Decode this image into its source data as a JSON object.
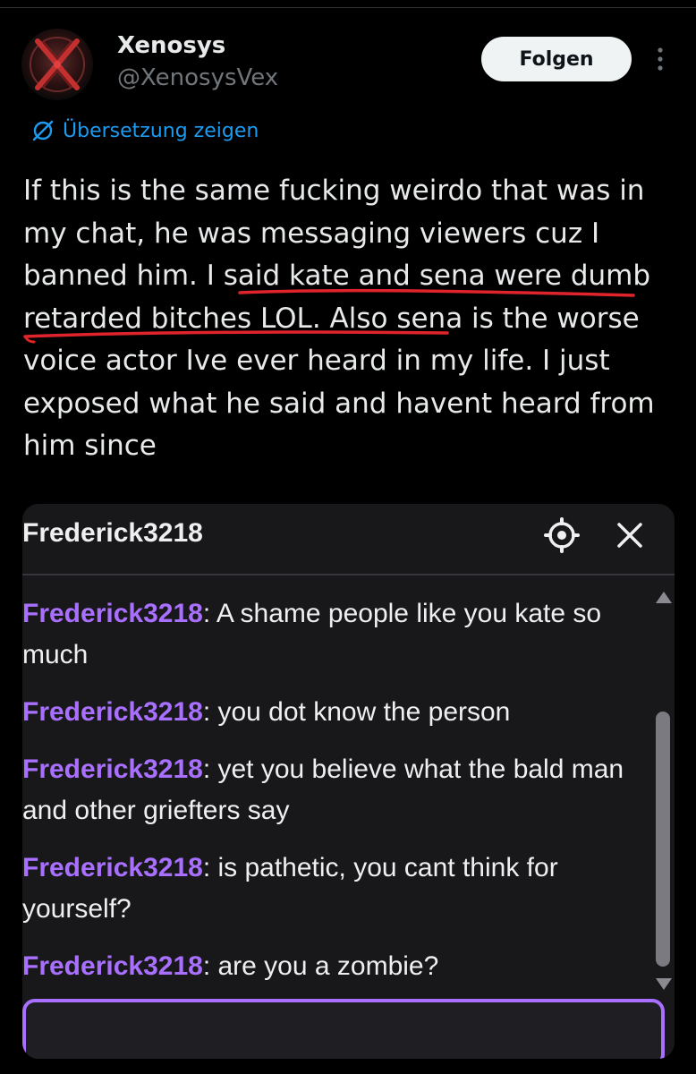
{
  "tweet": {
    "author": {
      "display_name": "Xenosys",
      "handle": "@XenosysVex",
      "avatar_icon": "x-logo-avatar"
    },
    "follow_label": "Folgen",
    "more_icon": "more-vertical-icon",
    "translate_label": "Übersetzung zeigen",
    "text": {
      "part1": "If this is the same fucking weirdo that was in my chat, he was messaging viewers cuz I banned him. ",
      "highlighted": "I said kate and sena were dumb retarded bitches LOL.",
      "part2": " Also sena is the worse voice actor Ive ever heard in my life. I just exposed what he said and havent heard from him since"
    },
    "annotation_color": "#e0242b"
  },
  "chat": {
    "title": "Frederick3218",
    "settings_icon": "gear-icon",
    "close_icon": "close-icon",
    "username_color": "#a970ff",
    "messages": [
      {
        "user": "Frederick3218",
        "text": ": A shame people like you kate so much"
      },
      {
        "user": "Frederick3218",
        "text": ": you dot know the person"
      },
      {
        "user": "Frederick3218",
        "text": ": yet you believe what the bald man and other griefters say"
      },
      {
        "user": "Frederick3218",
        "text": ": is pathetic, you cant think for yourself?"
      },
      {
        "user": "Frederick3218",
        "text": ": are you a zombie?"
      }
    ],
    "input_value": ""
  }
}
